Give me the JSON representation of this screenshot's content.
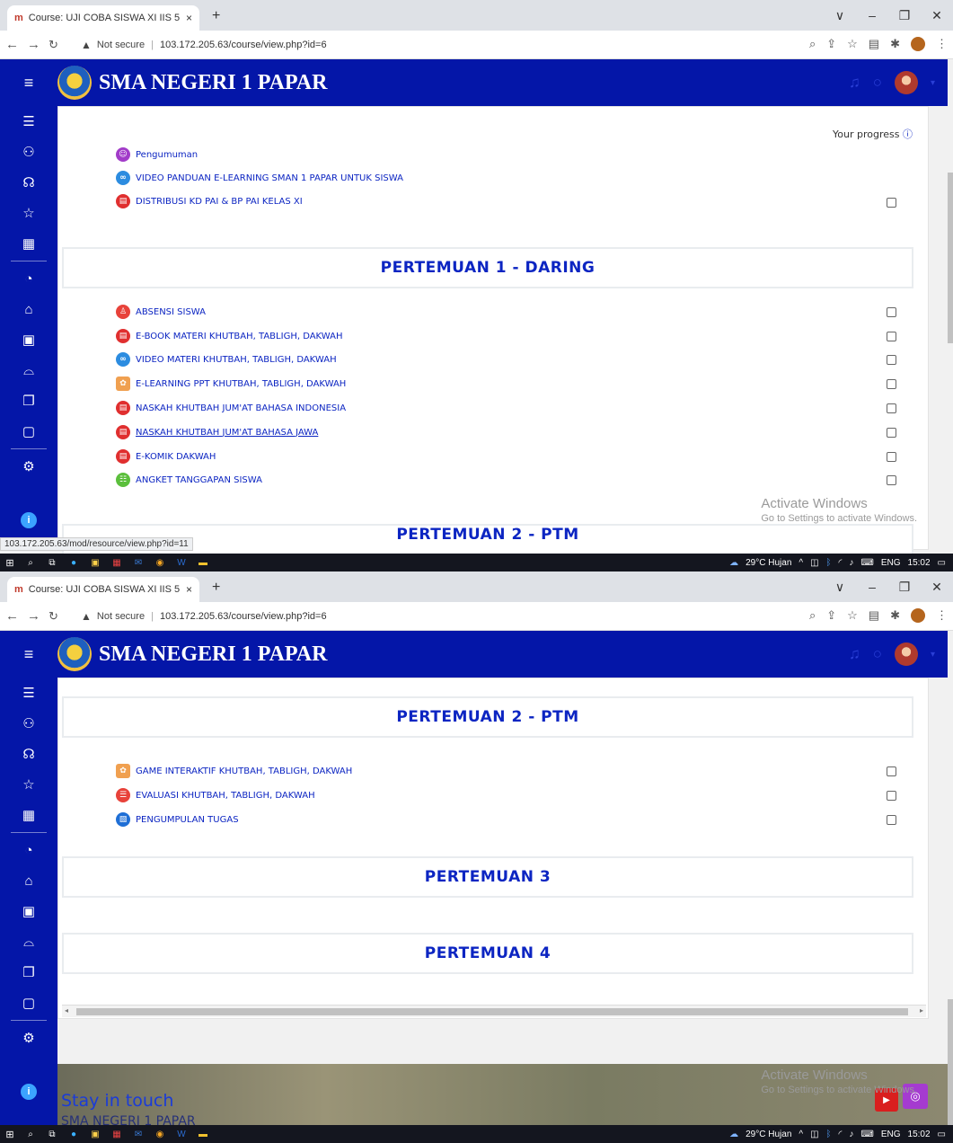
{
  "browser": {
    "tab_title": "Course: UJI COBA SISWA XI IIS 5",
    "tab_close": "×",
    "new_tab": "+",
    "window_controls": [
      "∨",
      "–",
      "❐",
      "✕"
    ],
    "security_label": "Not secure",
    "url": "103.172.205.63/course/view.php?id=6",
    "status_url": "103.172.205.63/mod/resource/view.php?id=11"
  },
  "site": {
    "name": "SMA NEGERI 1 PAPAR"
  },
  "sidebar_icons": [
    "list-icon",
    "user-icon",
    "badge-icon",
    "star-icon",
    "book-icon",
    "dashboard-icon",
    "home-icon",
    "calendar-icon",
    "graduation-icon",
    "files-icon",
    "clipboard-icon",
    "settings-icon"
  ],
  "progress": {
    "label": "Your progress",
    "help": "?"
  },
  "general": {
    "activities": [
      {
        "title": "Pengumuman",
        "type": "forum",
        "color": "#a23cc9",
        "checkbox": false
      },
      {
        "title": "VIDEO PANDUAN E-LEARNING SMAN 1 PAPAR UNTUK SISWA",
        "type": "url",
        "color": "#2c8ce0",
        "checkbox": false
      },
      {
        "title": "DISTRIBUSI KD PAI & BP PAI KELAS XI",
        "type": "pdf",
        "color": "#e02f2f",
        "checkbox": true
      }
    ]
  },
  "pertemuan1": {
    "title": "PERTEMUAN 1 - DARING",
    "activities": [
      {
        "title": "ABSENSI SISWA",
        "type": "attendance",
        "color": "#e8423a"
      },
      {
        "title": "E-BOOK MATERI KHUTBAH, TABLIGH, DAKWAH",
        "type": "pdf",
        "color": "#e02f2f"
      },
      {
        "title": "VIDEO MATERI KHUTBAH, TABLIGH, DAKWAH",
        "type": "url",
        "color": "#2c8ce0"
      },
      {
        "title": "E-LEARNING PPT KHUTBAH, TABLIGH, DAKWAH",
        "type": "scorm",
        "color": "#f0a050"
      },
      {
        "title": "NASKAH KHUTBAH JUM'AT BAHASA INDONESIA",
        "type": "pdf",
        "color": "#e02f2f"
      },
      {
        "title": "NASKAH KHUTBAH JUM'AT BAHASA JAWA",
        "type": "pdf",
        "color": "#e02f2f"
      },
      {
        "title": "E-KOMIK DAKWAH",
        "type": "pdf",
        "color": "#e02f2f"
      },
      {
        "title": "ANGKET TANGGAPAN SISWA",
        "type": "feedback",
        "color": "#5bbf3c"
      }
    ]
  },
  "pertemuan2": {
    "title": "PERTEMUAN 2 - PTM",
    "activities": [
      {
        "title": "GAME INTERAKTIF KHUTBAH, TABLIGH, DAKWAH",
        "type": "scorm",
        "color": "#f0a050"
      },
      {
        "title": "EVALUASI KHUTBAH, TABLIGH, DAKWAH",
        "type": "quiz",
        "color": "#e8423a"
      },
      {
        "title": "PENGUMPULAN TUGAS",
        "type": "assign",
        "color": "#1f6fd6"
      }
    ]
  },
  "pertemuan3": {
    "title": "PERTEMUAN 3"
  },
  "pertemuan4": {
    "title": "PERTEMUAN 4"
  },
  "footer": {
    "stay_in_touch": "Stay in touch",
    "school": "SMA NEGERI 1 PAPAR"
  },
  "watermark": {
    "line1": "Activate Windows",
    "line2": "Go to Settings to activate Windows."
  },
  "taskbar": {
    "weather": "29°C Hujan",
    "lang": "ENG",
    "time": "15:02"
  }
}
